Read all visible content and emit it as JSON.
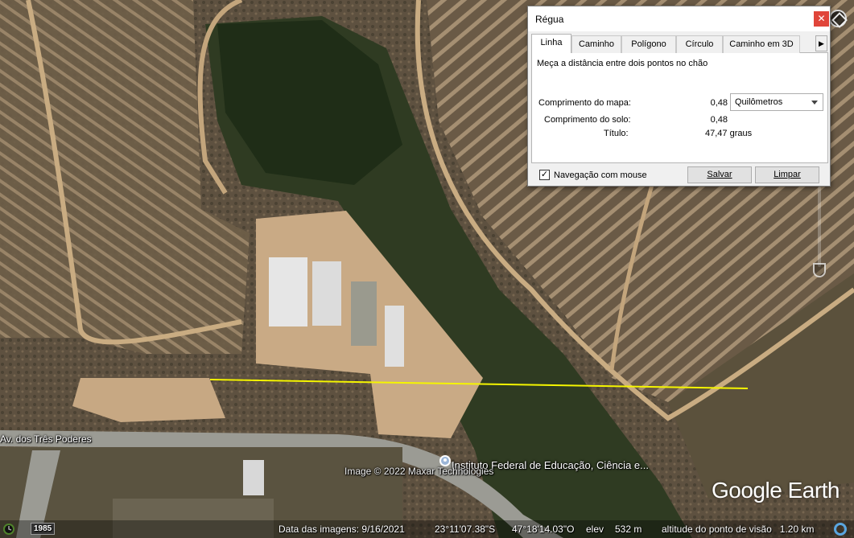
{
  "map": {
    "road_label": "Av. dos Três Poderes",
    "place_label": "Instituto Federal de Educação, Ciência e...",
    "copyright": "Image © 2022 Maxar Technologies",
    "logo_text": "Google Earth",
    "ruler_line_color": "#f5f500"
  },
  "status_bar": {
    "history_year": "1985",
    "imagery_date": "Data das imagens: 9/16/2021",
    "latitude": "23°11'07.38\"S",
    "longitude": "47°18'14.03\"O",
    "elevation_label": "elev",
    "elevation_value": "532 m",
    "eye_altitude": "altitude do ponto de visão   1.20 km"
  },
  "ruler_dialog": {
    "title": "Régua",
    "close_icon": "close-icon",
    "tabs": [
      "Linha",
      "Caminho",
      "Polígono",
      "Círculo",
      "Caminho em 3D"
    ],
    "active_tab": "Linha",
    "instruction": "Meça a distância entre dois pontos no chão",
    "map_length_label": "Comprimento do mapa:",
    "map_length_value": "0,48",
    "unit_selected": "Quilômetros",
    "ground_length_label": "Comprimento do solo:",
    "ground_length_value": "0,48",
    "heading_label": "Título:",
    "heading_value": "47,47 graus",
    "mouse_nav_label": "Navegação com mouse",
    "mouse_nav_checked": true,
    "save_label": "Salvar",
    "clear_label": "Limpar"
  }
}
